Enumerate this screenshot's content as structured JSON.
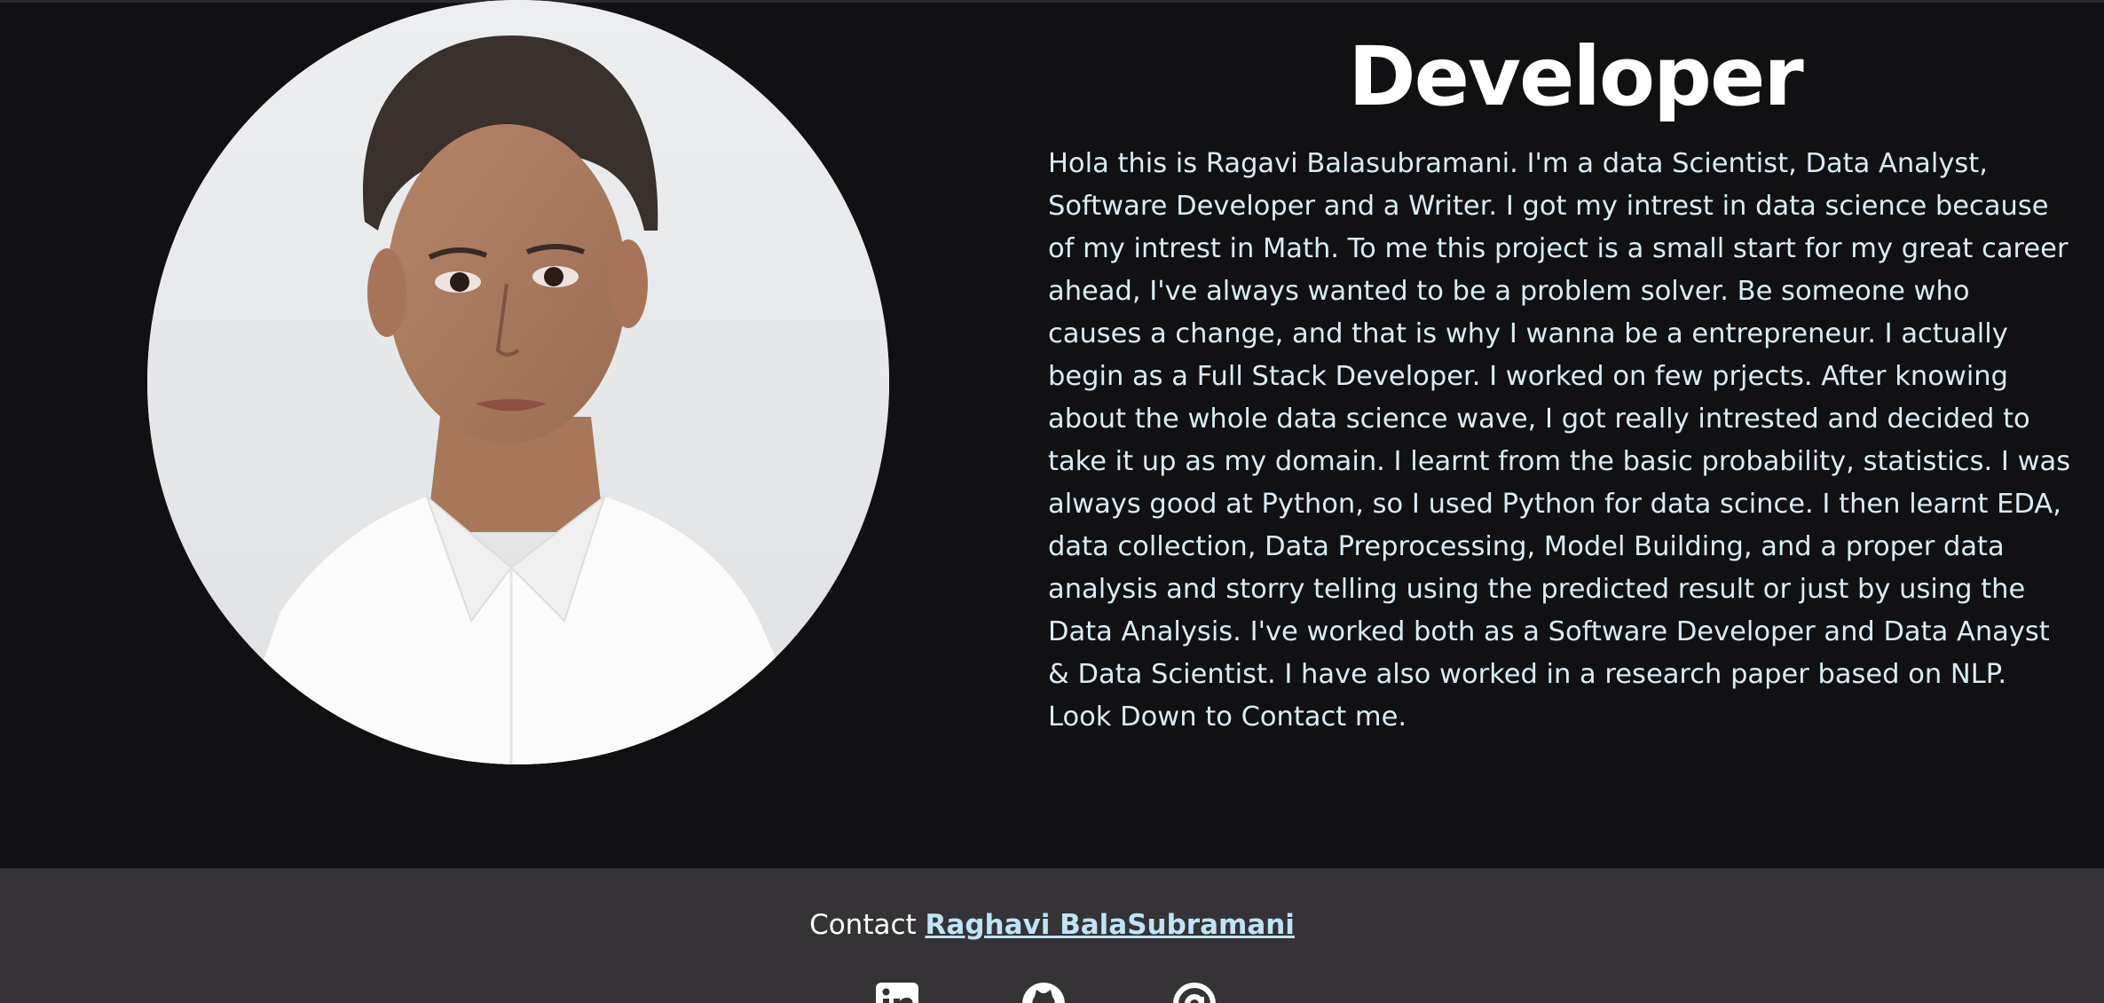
{
  "hero": {
    "title": "Developer",
    "bio": "Hola this is Ragavi Balasubramani. I'm a data Scientist, Data Analyst,\nSoftware Developer and a Writer. I got my intrest in data science because\nof my intrest in Math. To me this project is a small start for my great career\nahead, I've always wanted to be a problem solver. Be someone who\ncauses a change, and that is why I wanna be a entrepreneur. I actually\nbegin as a Full Stack Developer. I worked on few prjects. After knowing\nabout the whole data science wave, I got really intrested and decided to\ntake it up as my domain. I learnt from the basic probability, statistics. I was\nalways good at Python, so I used Python for data scince. I then learnt EDA,\ndata collection, Data Preprocessing, Model Building, and a proper data\nanalysis and storry telling using the predicted result or just by using the\nData Analysis. I've worked both as a Software Developer and Data Anayst\n& Data Scientist. I have also worked in a research paper based on NLP.\nLook Down to Contact me."
  },
  "footer": {
    "contact_prefix": "Contact",
    "contact_name": "Raghavi BalaSubramani",
    "social": [
      {
        "icon": "linkedin-icon"
      },
      {
        "icon": "github-icon"
      },
      {
        "icon": "at-sign-icon"
      }
    ]
  },
  "colors": {
    "page_background": "#111012",
    "footer_background": "#353336",
    "title_text": "#ffffff",
    "bio_text": "#d9ecf6",
    "link_text": "#bfe4f5"
  }
}
